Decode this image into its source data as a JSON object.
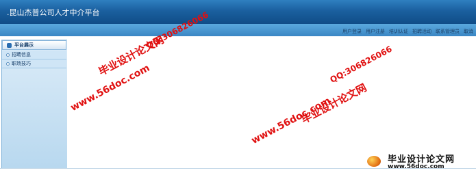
{
  "header": {
    "title": ".昆山杰普公司人才中介平台"
  },
  "nav": {
    "links": [
      "用户登录",
      "用户注册",
      "培训认证",
      "招聘活动",
      "联系管理员",
      "取消"
    ]
  },
  "sidebar": {
    "heading": "平台展示",
    "items": [
      {
        "label": "招聘信息"
      },
      {
        "label": "职场技巧"
      }
    ]
  },
  "watermarks": {
    "site_cn": "毕业设计论文网",
    "url": "www.56doc.com",
    "qq": "QQ:306826066"
  },
  "logo": {
    "text": "毕业设计论文网",
    "url": "www.56doc.com"
  },
  "colors": {
    "header": "#1a5f9e",
    "watermark": "#e01010"
  }
}
